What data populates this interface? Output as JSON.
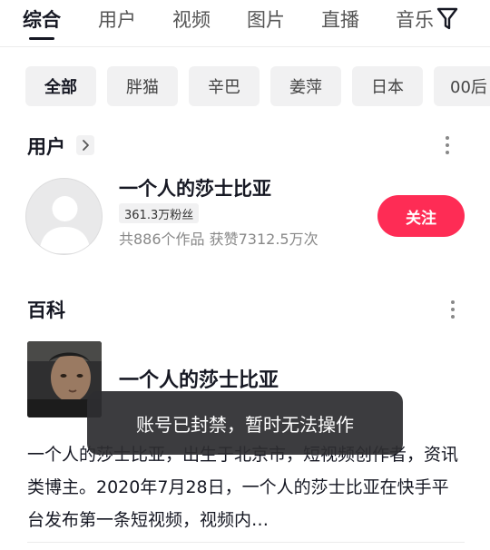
{
  "tabs": [
    {
      "label": "综合",
      "active": true
    },
    {
      "label": "用户"
    },
    {
      "label": "视频"
    },
    {
      "label": "图片"
    },
    {
      "label": "直播"
    },
    {
      "label": "音乐"
    }
  ],
  "filter_icon": "filter-icon",
  "chips": [
    {
      "label": "全部",
      "active": true
    },
    {
      "label": "胖猫"
    },
    {
      "label": "辛巴"
    },
    {
      "label": "姜萍"
    },
    {
      "label": "日本"
    },
    {
      "label": "00后"
    }
  ],
  "user_section": {
    "title": "用户",
    "chevron_icon": "chevron-right-icon",
    "more_icon": "more-vertical-icon",
    "name": "一个人的莎士比亚",
    "fans": "361.3万粉丝",
    "stats": "共886个作品 获赞7312.5万次",
    "follow_label": "关注"
  },
  "wiki_section": {
    "title": "百科",
    "more_icon": "more-vertical-icon",
    "name": "一个人的莎士比亚",
    "description": "一个人的莎士比亚，出生于北京市，短视频创作者，资讯类博主。2020年7月28日，一个人的莎士比亚在快手平台发布第一条短视频，视频内…"
  },
  "toast": "账号已封禁，暂时无法操作",
  "colors": {
    "accent": "#fe2c55",
    "text_primary": "#161823",
    "chip_bg": "#f1f1f2"
  }
}
